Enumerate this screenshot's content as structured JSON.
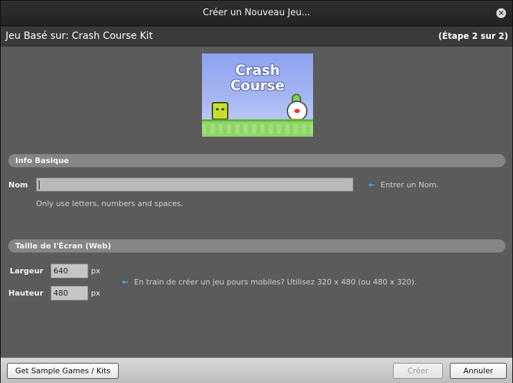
{
  "window": {
    "title": "Créer un Nouveau Jeu...",
    "close_icon": "×"
  },
  "subheader": {
    "based_on": "Jeu Basé sur: Crash Course Kit",
    "step": "(Étape 2 sur 2)"
  },
  "preview": {
    "title_line1": "Crash",
    "title_line2": "Course"
  },
  "basic_info": {
    "section_title": "Info Basique",
    "name_label": "Nom",
    "name_value": "",
    "name_hint": "Entrer un Nom.",
    "name_help": "Only use letters, numbers and spaces."
  },
  "screen_size": {
    "section_title": "Taille de l'Écran (Web)",
    "width_label": "Largeur",
    "width_value": "640",
    "height_label": "Hauteur",
    "height_value": "480",
    "unit": "px",
    "mobile_hint": "En train de créer un jeu pours mobiles? Utilisez 320 x 480 (ou 480 x 320)."
  },
  "footer": {
    "sample_button": "Get Sample Games / Kits",
    "create_button": "Créer",
    "cancel_button": "Annuler"
  },
  "colors": {
    "accent_arrow": "#4fb3ff",
    "panel_bg": "#5b5b5b",
    "section_bar": "#858585"
  }
}
